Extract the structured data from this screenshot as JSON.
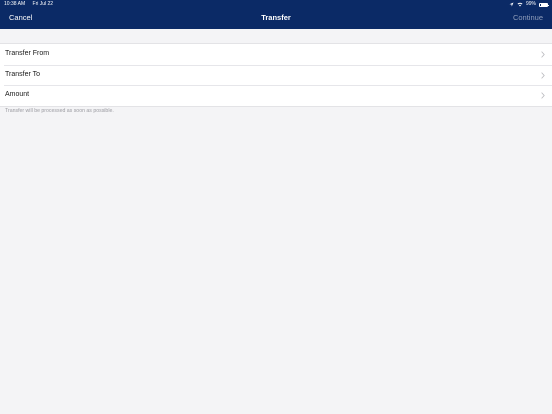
{
  "status_bar": {
    "time": "10:38 AM",
    "date": "Fri Jul 22",
    "battery": "99%"
  },
  "nav": {
    "cancel_label": "Cancel",
    "title": "Transfer",
    "continue_label": "Continue"
  },
  "form": {
    "rows": [
      {
        "label": "Transfer From",
        "icon": "chevron-right-icon"
      },
      {
        "label": "Transfer To",
        "icon": "chevron-right-icon"
      },
      {
        "label": "Amount",
        "icon": "chevron-right-icon"
      }
    ],
    "footer_note": "Transfer will be processed as soon as possible."
  },
  "colors": {
    "header_bg": "#0b2a66",
    "page_bg": "#f4f4f6",
    "disabled_action": "#8f9dba"
  },
  "icons": {
    "location": "location-arrow-icon",
    "wifi": "wifi-icon",
    "battery": "battery-icon"
  }
}
